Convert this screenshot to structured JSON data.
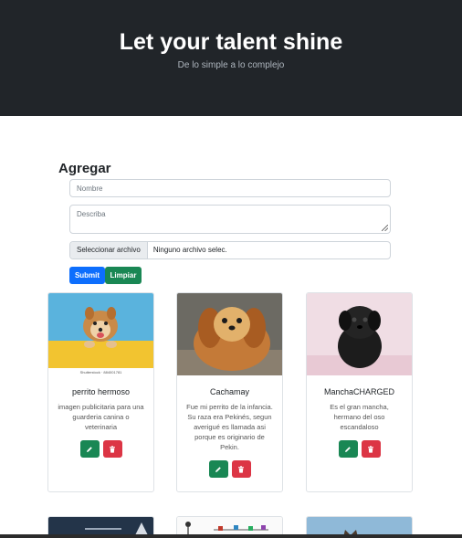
{
  "header": {
    "title": "Let your talent shine",
    "subtitle": "De lo simple a lo complejo"
  },
  "form": {
    "heading": "Agregar",
    "name_placeholder": "Nombre",
    "desc_placeholder": "Describa",
    "file_button": "Seleccionar archivo",
    "file_status": "Ninguno archivo selec.",
    "submit_label": "Submit",
    "clear_label": "Limpiar"
  },
  "cards": [
    {
      "title": "perrito hermoso",
      "desc": "imagen publicitaria para una guarderia canina o veterinaria",
      "image_credit": "Shutterstock · 884001781"
    },
    {
      "title": "Cachamay",
      "desc": "Fue mi perrito de la infancia. Su raza era Pekinés, segun averigué es llamada asi porque es originario de Pekin."
    },
    {
      "title": "ManchaCHARGED",
      "desc": "Es el gran mancha, hermano del oso escandaloso"
    }
  ],
  "colors": {
    "hero_bg": "#212529",
    "primary": "#0d6efd",
    "success": "#198754",
    "danger": "#dc3545"
  }
}
